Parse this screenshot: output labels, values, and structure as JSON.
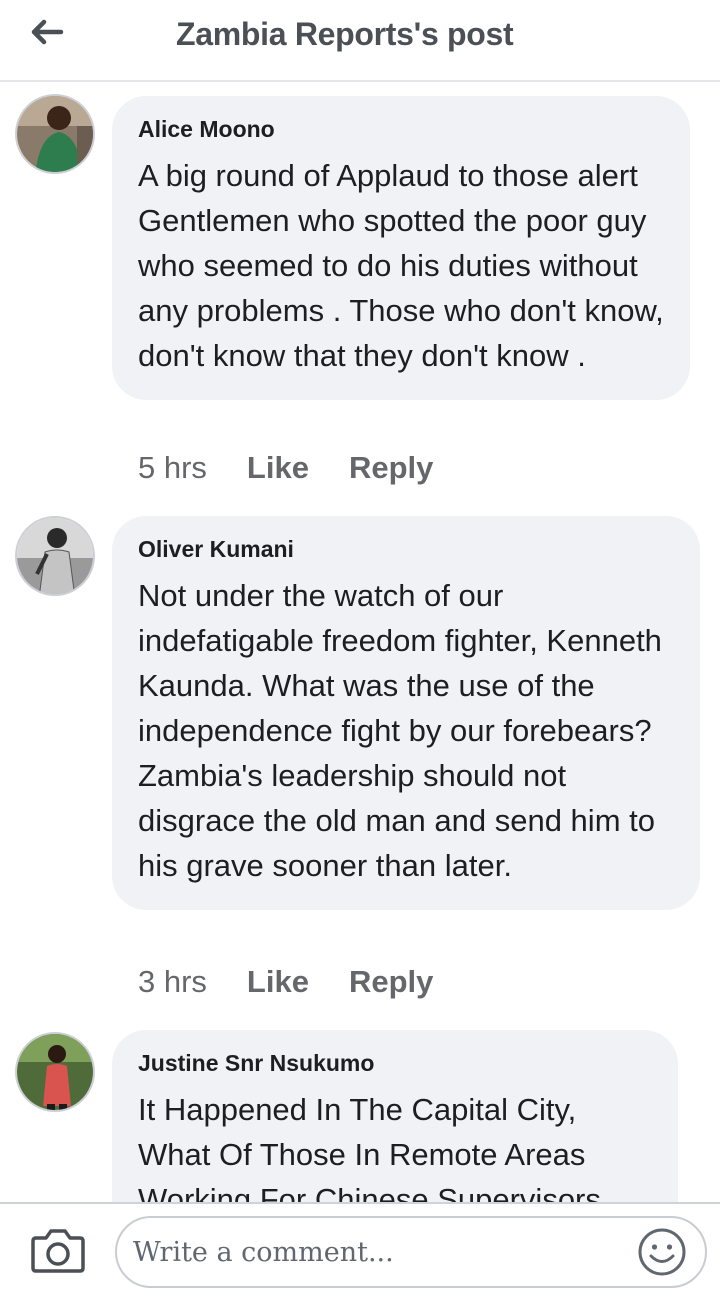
{
  "header": {
    "title": "Zambia Reports's post",
    "back_icon": "arrow-left-icon"
  },
  "comments": [
    {
      "author": "Alice Moono",
      "text": "A big round of Applaud to those alert Gentlemen who spotted the poor guy who seemed to do his duties without any problems . Those who don't know,  don't know that they don't know .",
      "time": "5 hrs",
      "like_label": "Like",
      "reply_label": "Reply"
    },
    {
      "author": "Oliver Kumani",
      "text": "Not under the watch of our indefatigable freedom fighter, Kenneth Kaunda. What was the use of the independence fight by our forebears? Zambia's leadership should not disgrace the old man and send him to his grave sooner than later.",
      "time": "3 hrs",
      "like_label": "Like",
      "reply_label": "Reply"
    },
    {
      "author": "Justine Snr Nsukumo",
      "text": "It Happened In The Capital City, What Of Those In Remote Areas Working For Chinese Supervisors",
      "time": "",
      "like_label": "",
      "reply_label": ""
    }
  ],
  "composer": {
    "placeholder": "Write a comment...",
    "camera_icon": "camera-icon",
    "emoji_icon": "smiley-icon"
  },
  "colors": {
    "bubble": "#f0f2f5",
    "meta_text": "#65676b",
    "header_text": "#4b4f56"
  }
}
